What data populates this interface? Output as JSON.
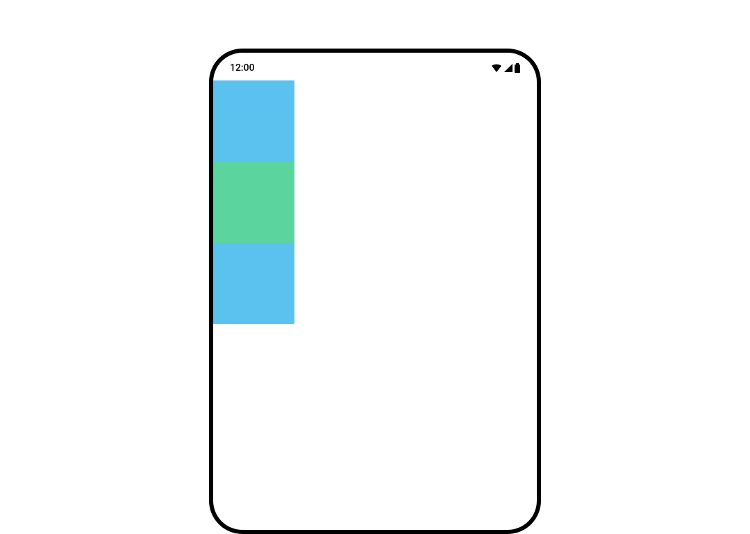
{
  "status_bar": {
    "time": "12:00"
  },
  "boxes": {
    "top_color": "#5bc1ee",
    "middle_color": "#5cd49e",
    "bottom_color": "#5bc1ee"
  }
}
